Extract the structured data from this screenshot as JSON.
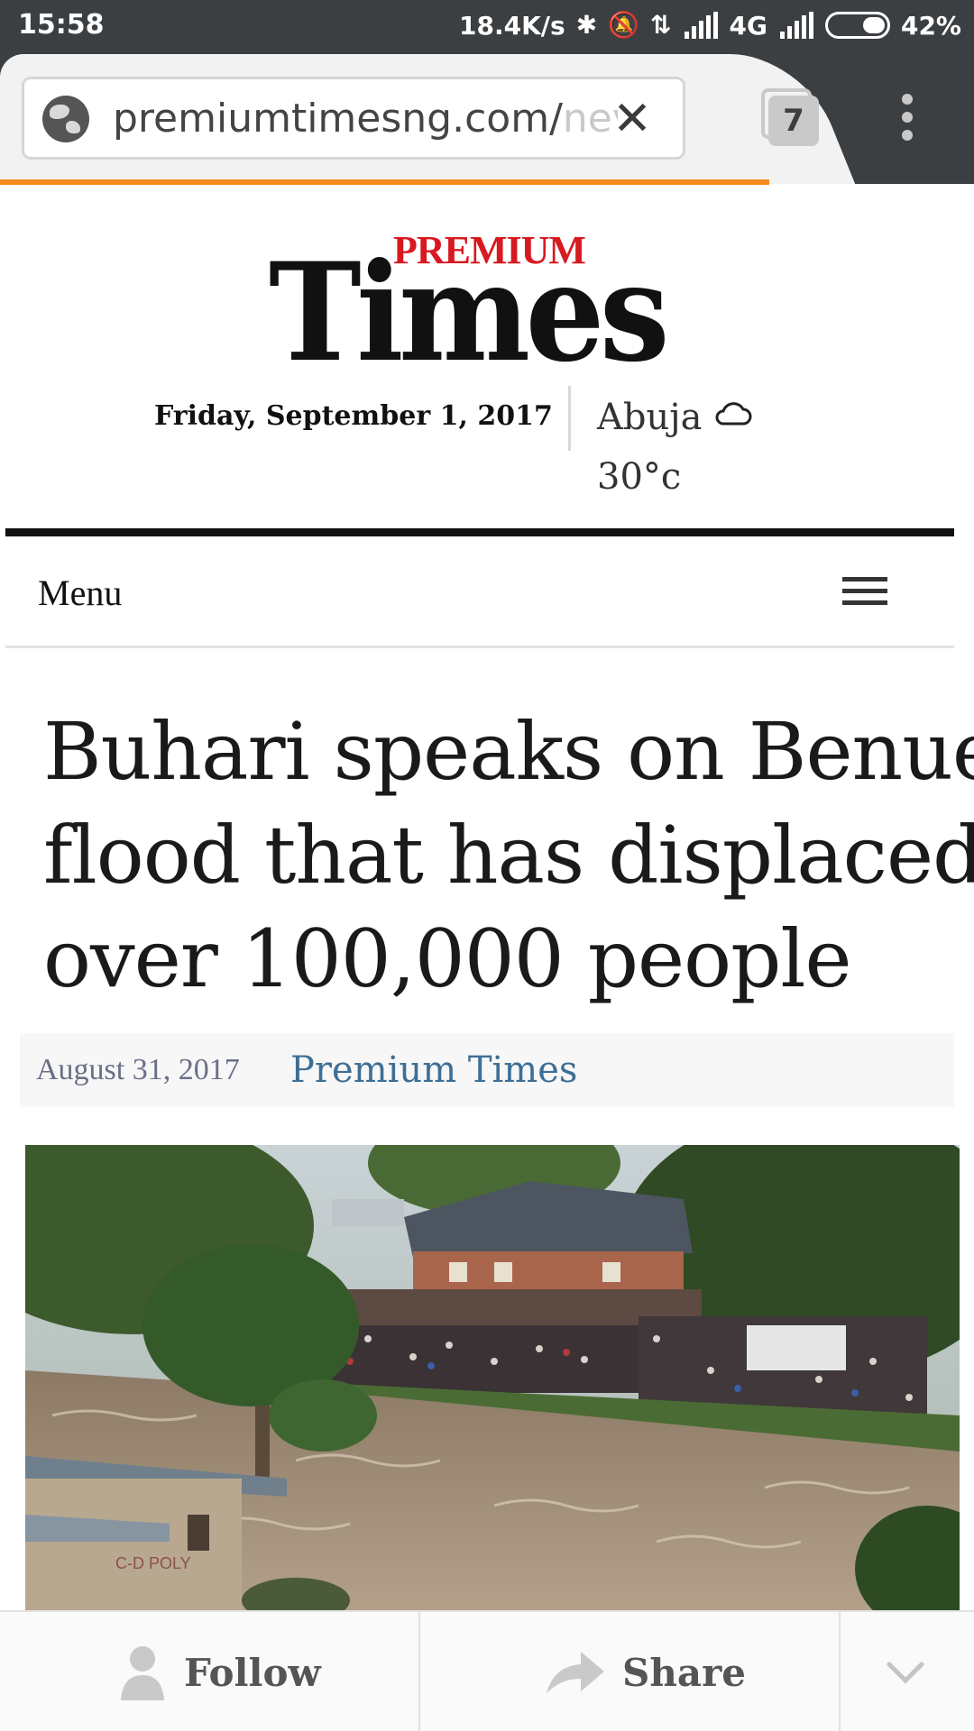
{
  "status_bar": {
    "time": "15:58",
    "speed": "18.4K/s",
    "network": "4G",
    "battery": "42%",
    "icons": [
      "bluetooth-icon",
      "silent-icon",
      "data-arrows-icon",
      "signal-icon",
      "battery-icon"
    ]
  },
  "browser": {
    "url_main": "premiumtimesng.com/",
    "url_fade": "nev",
    "tab_count": "7",
    "load_progress": 0.79
  },
  "site": {
    "logo_premium": "PREMIUM",
    "logo_times": "Times",
    "date": "Friday, September 1, 2017",
    "weather_city": "Abuja",
    "weather_temp": "30°c",
    "menu_label": "Menu"
  },
  "article": {
    "headline_lines": [
      "Buhari speaks on Benue",
      "flood that has displaced",
      "over 100,000 people"
    ],
    "date": "August 31, 2017",
    "author": "Premium Times",
    "photo_sign_text": "C-D POLY"
  },
  "actions": {
    "follow_label": "Follow",
    "share_label": "Share"
  },
  "colors": {
    "chrome_dark": "#3c3f42",
    "progress_orange": "#f58a1f",
    "logo_red": "#d71920",
    "author_blue": "#3d6f96"
  }
}
